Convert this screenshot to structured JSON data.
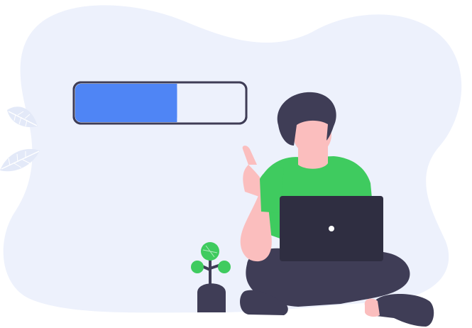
{
  "illustration": {
    "subject": "person-with-laptop-loading",
    "progress_fraction": 0.6,
    "colors": {
      "background_blob": "#EDF1FC",
      "leaf": "#E3E9F8",
      "progress_fill": "#4F85F5",
      "progress_track": "#EDF1FC",
      "progress_border": "#3F3D56",
      "hair": "#3F3D56",
      "skin": "#FBBEBE",
      "shirt": "#3FCB5F",
      "laptop": "#2F2E41",
      "laptop_dot": "#FFFFFF",
      "pants": "#3F3D56",
      "shoes": "#3F3D56",
      "plant_leaf": "#3FCB5F",
      "plant_stem": "#3F3D56",
      "pot": "#3F3D56"
    }
  }
}
